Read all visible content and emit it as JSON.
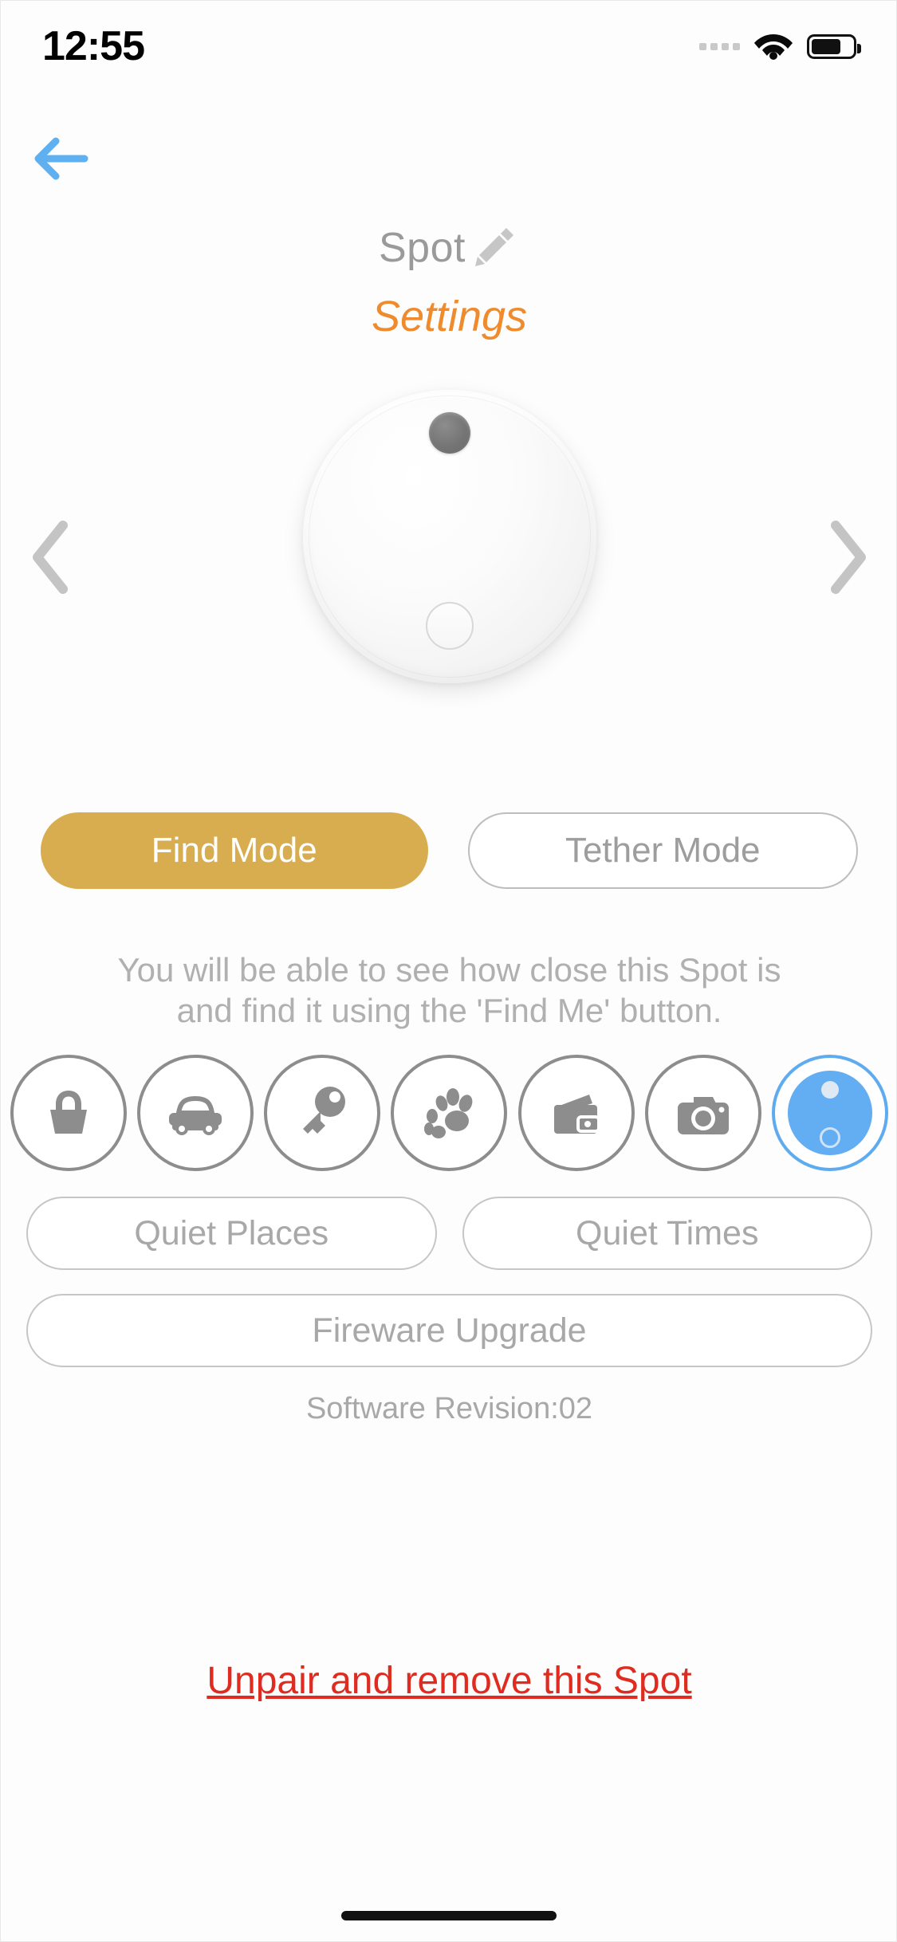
{
  "status_bar": {
    "time": "12:55",
    "cellular_icon": "cellular-dots-icon",
    "wifi_icon": "wifi-icon",
    "battery_icon": "battery-icon"
  },
  "nav": {
    "back_icon": "back-arrow-icon",
    "back_color": "#5fb0f0",
    "prev_icon": "chevron-left-icon",
    "next_icon": "chevron-right-icon"
  },
  "header": {
    "device_name": "Spot",
    "edit_icon": "pencil-icon",
    "page_title": "Settings",
    "title_color": "#ef8b2c"
  },
  "device_preview": {
    "body_icon": "spot-tracker-device",
    "led_icon": "device-led-dot",
    "button_icon": "device-button"
  },
  "modes": {
    "active_color": "#d7ad4f",
    "options": [
      {
        "label": "Find Mode",
        "state": "active"
      },
      {
        "label": "Tether Mode",
        "state": "inactive"
      }
    ],
    "description_line1": "You will be able to see how close this Spot is",
    "description_line2": "and find it using the 'Find Me' button."
  },
  "categories": [
    {
      "name": "bag",
      "icon": "bag-icon",
      "selected": false
    },
    {
      "name": "car",
      "icon": "car-icon",
      "selected": false
    },
    {
      "name": "key",
      "icon": "key-icon",
      "selected": false
    },
    {
      "name": "pet",
      "icon": "paw-icon",
      "selected": false
    },
    {
      "name": "wallet",
      "icon": "wallet-icon",
      "selected": false
    },
    {
      "name": "camera",
      "icon": "camera-icon",
      "selected": false
    },
    {
      "name": "spot",
      "icon": "spot-device-icon",
      "selected": true
    }
  ],
  "selected_category_color": "#5fabf0",
  "actions": {
    "quiet_places": "Quiet Places",
    "quiet_times": "Quiet Times",
    "firmware_upgrade": "Fireware Upgrade"
  },
  "software_revision": "Software Revision:02",
  "unpair": {
    "label": "Unpair and remove this Spot",
    "color": "#e02b20"
  }
}
